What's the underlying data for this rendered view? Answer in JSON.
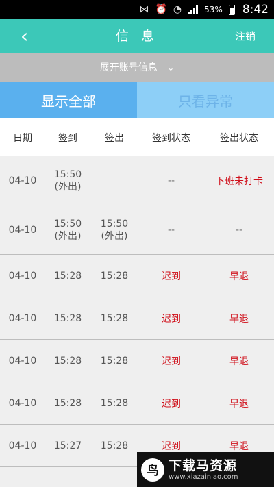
{
  "status_bar": {
    "battery": "53%",
    "time": "8:42"
  },
  "titlebar": {
    "back_icon": "‹",
    "title": "信 息",
    "logout": "注销"
  },
  "expand": {
    "label": "展开账号信息",
    "chevron": "⌄"
  },
  "tabs": [
    {
      "label": "显示全部",
      "active": true
    },
    {
      "label": "只看异常",
      "active": false
    }
  ],
  "table": {
    "headers": [
      "日期",
      "签到",
      "签出",
      "签到状态",
      "签出状态"
    ],
    "rows": [
      {
        "date": "04-10",
        "in": "15:50",
        "in_note": "(外出)",
        "out": "",
        "out_note": "",
        "in_status": "--",
        "out_status": "下班未打卡"
      },
      {
        "date": "04-10",
        "in": "15:50",
        "in_note": "(外出)",
        "out": "15:50",
        "out_note": "(外出)",
        "in_status": "--",
        "out_status": "--"
      },
      {
        "date": "04-10",
        "in": "15:28",
        "in_note": "",
        "out": "15:28",
        "out_note": "",
        "in_status": "迟到",
        "out_status": "早退"
      },
      {
        "date": "04-10",
        "in": "15:28",
        "in_note": "",
        "out": "15:28",
        "out_note": "",
        "in_status": "迟到",
        "out_status": "早退"
      },
      {
        "date": "04-10",
        "in": "15:28",
        "in_note": "",
        "out": "15:28",
        "out_note": "",
        "in_status": "迟到",
        "out_status": "早退"
      },
      {
        "date": "04-10",
        "in": "15:28",
        "in_note": "",
        "out": "15:28",
        "out_note": "",
        "in_status": "迟到",
        "out_status": "早退"
      },
      {
        "date": "04-10",
        "in": "15:27",
        "in_note": "",
        "out": "15:28",
        "out_note": "",
        "in_status": "迟到",
        "out_status": "早退"
      }
    ]
  },
  "watermark": {
    "name": "下载马资源",
    "url": "www.xiazainiao.com"
  },
  "colors": {
    "teal": "#3cc8b8",
    "tab_active": "#5ab0ee",
    "tab_inactive": "#8dcff7",
    "alert_red": "#d0101b"
  }
}
